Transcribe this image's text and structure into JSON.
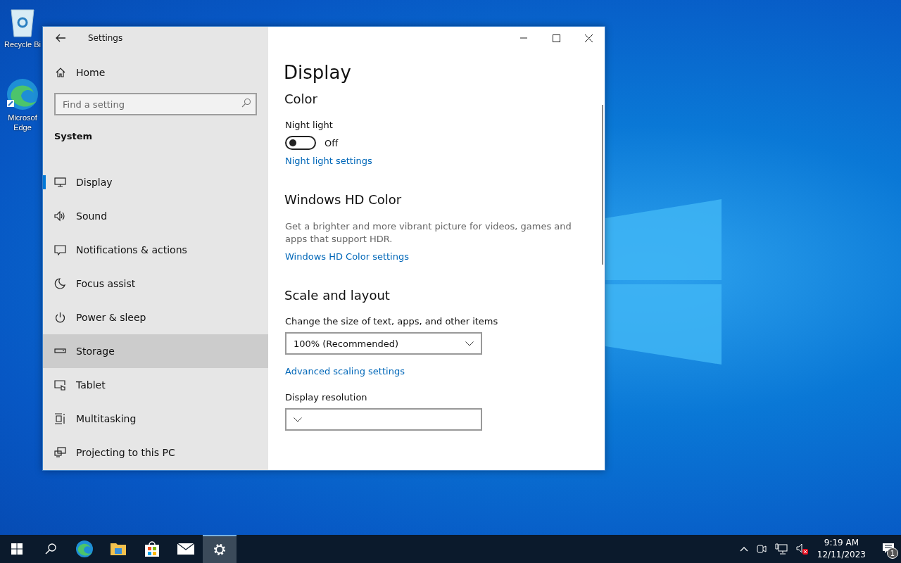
{
  "desktop_icons": [
    {
      "kind": "recycle",
      "label": "Recycle Bi"
    },
    {
      "kind": "edge",
      "label": "Microsof Edge"
    }
  ],
  "window": {
    "title": "Settings"
  },
  "sidebar": {
    "home": "Home",
    "search": {
      "placeholder": "Find a setting"
    },
    "section": "System",
    "items": [
      {
        "kind": "display",
        "label": "Display",
        "selected": true,
        "hovered": false
      },
      {
        "kind": "sound",
        "label": "Sound",
        "selected": false,
        "hovered": false
      },
      {
        "kind": "notifications",
        "label": "Notifications & actions",
        "selected": false,
        "hovered": false
      },
      {
        "kind": "focus",
        "label": "Focus assist",
        "selected": false,
        "hovered": false
      },
      {
        "kind": "power",
        "label": "Power & sleep",
        "selected": false,
        "hovered": false
      },
      {
        "kind": "storage",
        "label": "Storage",
        "selected": false,
        "hovered": true
      },
      {
        "kind": "tablet",
        "label": "Tablet",
        "selected": false,
        "hovered": false
      },
      {
        "kind": "multitasking",
        "label": "Multitasking",
        "selected": false,
        "hovered": false
      },
      {
        "kind": "projecting",
        "label": "Projecting to this PC",
        "selected": false,
        "hovered": false
      }
    ]
  },
  "page": {
    "title": "Display",
    "sections": [
      {
        "heading": "Color",
        "items": [
          {
            "kind": "label",
            "text": "Night light"
          },
          {
            "kind": "toggle",
            "on": false,
            "text": "Off"
          },
          {
            "kind": "link",
            "text": "Night light settings"
          }
        ]
      },
      {
        "heading": "Windows HD Color",
        "items": [
          {
            "kind": "description",
            "text": "Get a brighter and more vibrant picture for videos, games and apps that support HDR."
          },
          {
            "kind": "link",
            "text": "Windows HD Color settings"
          }
        ]
      },
      {
        "heading": "Scale and layout",
        "items": [
          {
            "kind": "label",
            "text": "Change the size of text, apps, and other items"
          },
          {
            "kind": "dropdown",
            "text": "100% (Recommended)"
          },
          {
            "kind": "link",
            "text": "Advanced scaling settings"
          },
          {
            "kind": "label",
            "text": "Display resolution"
          },
          {
            "kind": "dropdown"
          }
        ]
      }
    ]
  },
  "taskbar": {
    "apps": [
      {
        "kind": "edge",
        "active": false
      },
      {
        "kind": "explorer",
        "active": false
      },
      {
        "kind": "store",
        "active": false
      },
      {
        "kind": "mail",
        "active": false
      },
      {
        "kind": "settings",
        "active": true
      }
    ],
    "time": "9:19 AM",
    "date": "12/11/2023",
    "notification_count": "1"
  }
}
